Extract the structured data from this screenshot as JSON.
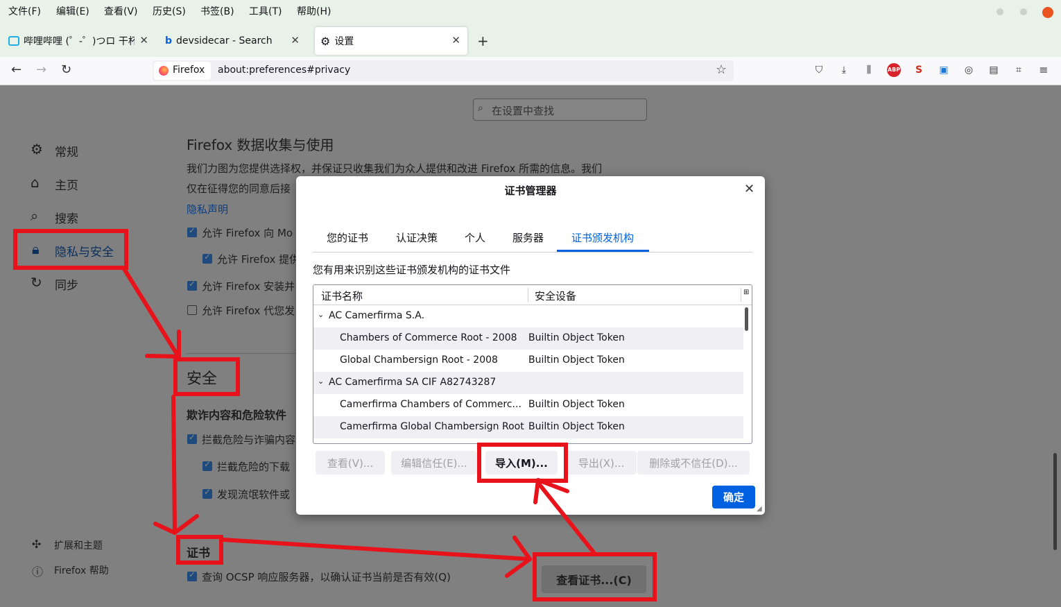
{
  "menubar": {
    "items": [
      "文件(F)",
      "编辑(E)",
      "查看(V)",
      "历史(S)",
      "书签(B)",
      "工具(T)",
      "帮助(H)"
    ]
  },
  "tabs": [
    {
      "label": "哔哩哔哩 (゜-゜)つロ 干杯",
      "icon": "bilibili-icon"
    },
    {
      "label": "devsidecar - Search",
      "icon": "bing-icon"
    },
    {
      "label": "设置",
      "icon": "gear-icon"
    }
  ],
  "navbar": {
    "identity": "Firefox",
    "url": "about:preferences#privacy"
  },
  "search": {
    "placeholder": "在设置中查找"
  },
  "sidebar": {
    "items": [
      {
        "label": "常规",
        "icon": "gear-icon"
      },
      {
        "label": "主页",
        "icon": "home-icon"
      },
      {
        "label": "搜索",
        "icon": "search-icon"
      },
      {
        "label": "隐私与安全",
        "icon": "lock-icon"
      },
      {
        "label": "同步",
        "icon": "sync-icon"
      }
    ],
    "footer": [
      {
        "label": "扩展和主题",
        "icon": "puzzle-icon"
      },
      {
        "label": "Firefox 帮助",
        "icon": "help-icon"
      }
    ]
  },
  "content": {
    "data_heading": "Firefox 数据收集与使用",
    "data_desc_1": "我们力图为您提供选择权，并保证只收集我们为众人提供和改进 Firefox 所需的信息。我们",
    "data_desc_2": "仅在征得您的同意后接",
    "privacy_link": "隐私声明",
    "data_options": [
      "允许 Firefox 向 Mo",
      "允许 Firefox 提供",
      "允许 Firefox 安装并",
      "允许 Firefox 代您发"
    ],
    "security_heading": "安全",
    "deceptive_heading": "欺诈内容和危险软件",
    "security_options": [
      "拦截危险与诈骗内容",
      "拦截危险的下载",
      "发现流氓软件或"
    ],
    "cert_heading": "证书",
    "ocsp_label": "查询 OCSP 响应服务器，以确认证书当前是否有效(Q)",
    "view_certs_button": "查看证书...(C)"
  },
  "dialog": {
    "title": "证书管理器",
    "tabs": [
      "您的证书",
      "认证决策",
      "个人",
      "服务器",
      "证书颁发机构"
    ],
    "description": "您有用来识别这些证书颁发机构的证书文件",
    "columns": [
      "证书名称",
      "安全设备"
    ],
    "rows": [
      {
        "name": "AC Camerfirma S.A.",
        "device": "",
        "group": true
      },
      {
        "name": "Chambers of Commerce Root - 2008",
        "device": "Builtin Object Token",
        "group": false
      },
      {
        "name": "Global Chambersign Root - 2008",
        "device": "Builtin Object Token",
        "group": false
      },
      {
        "name": "AC Camerfirma SA CIF A82743287",
        "device": "",
        "group": true
      },
      {
        "name": "Camerfirma Chambers of Commerc...",
        "device": "Builtin Object Token",
        "group": false
      },
      {
        "name": "Camerfirma Global Chambersign Root",
        "device": "Builtin Object Token",
        "group": false
      }
    ],
    "buttons": {
      "view": "查看(V)...",
      "edit_trust": "编辑信任(E)...",
      "import": "导入(M)...",
      "export": "导出(X)...",
      "delete": "删除或不信任(D)...",
      "ok": "确定"
    }
  },
  "colors": {
    "accent": "#0061e0",
    "annotation": "#e8121b",
    "chrome": "#e8f2e8"
  }
}
